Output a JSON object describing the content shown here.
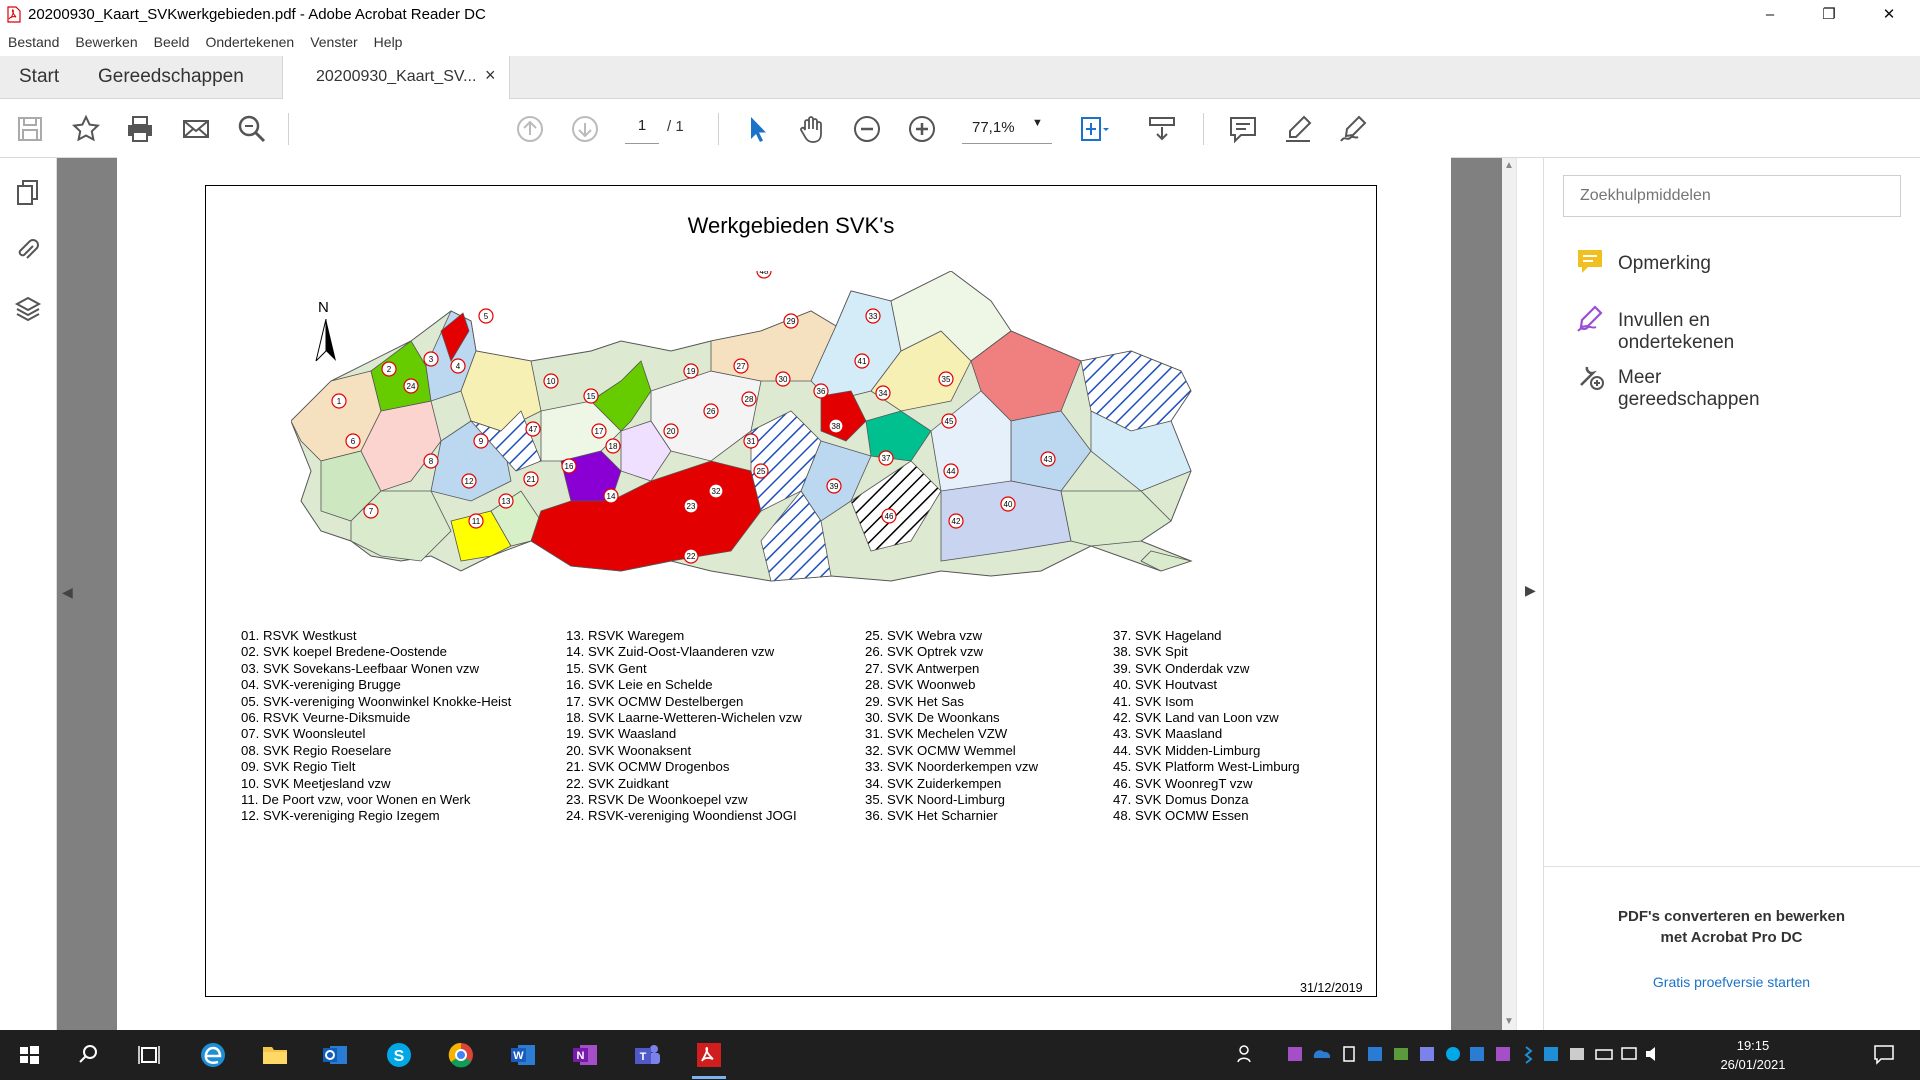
{
  "window": {
    "title": "20200930_Kaart_SVKwerkgebieden.pdf - Adobe Acrobat Reader DC",
    "minimize": "–",
    "maximize": "❐",
    "close": "✕"
  },
  "menu": [
    "Bestand",
    "Bewerken",
    "Beeld",
    "Ondertekenen",
    "Venster",
    "Help"
  ],
  "tabs": {
    "start": "Start",
    "tools": "Gereedschappen",
    "document": "20200930_Kaart_SV...",
    "close": "×"
  },
  "toolbar": {
    "icons": [
      "save-icon",
      "star-icon",
      "print-icon",
      "mail-icon",
      "zoom-search-icon",
      "page-up-icon",
      "page-down-icon",
      "select-cursor-icon",
      "hand-icon",
      "zoom-out-icon",
      "zoom-in-icon",
      "fit-page-icon",
      "scroll-mode-icon",
      "comment-icon",
      "highlight-pen-icon",
      "sign-icon"
    ],
    "page_current": "1",
    "page_total": "/ 1",
    "zoom": "77,1%"
  },
  "map": {
    "title": "Werkgebieden SVK's",
    "north": "N",
    "date": "31/12/2019",
    "colors": {
      "red": "#e30000",
      "green": "#66cc00",
      "purple": "#8a00d4",
      "yellow": "#ffff00",
      "teal": "#00c090",
      "pink": "#f08080",
      "lightblue": "#bcd7f0",
      "hatch": "#1f4fbf"
    }
  },
  "legend": {
    "col1": [
      "01. RSVK Westkust",
      "02. SVK koepel Bredene-Oostende",
      "03. SVK Sovekans-Leefbaar Wonen vzw",
      "04. SVK-vereniging Brugge",
      "05. SVK-vereniging Woonwinkel Knokke-Heist",
      "06. RSVK Veurne-Diksmuide",
      "07. SVK Woonsleutel",
      "08. SVK Regio Roeselare",
      "09. SVK Regio Tielt",
      "10. SVK Meetjesland vzw",
      "11. De Poort vzw, voor Wonen en Werk",
      "12. SVK-vereniging Regio Izegem"
    ],
    "col2": [
      "13. RSVK Waregem",
      "14. SVK Zuid-Oost-Vlaanderen vzw",
      "15. SVK Gent",
      "16. SVK Leie en Schelde",
      "17. SVK OCMW Destelbergen",
      "18. SVK Laarne-Wetteren-Wichelen vzw",
      "19. SVK Waasland",
      "20. SVK Woonaksent",
      "21. SVK OCMW Drogenbos",
      "22. SVK Zuidkant",
      "23. RSVK De Woonkoepel vzw",
      "24. RSVK-vereniging Woondienst JOGI"
    ],
    "col3": [
      "25. SVK Webra vzw",
      "26. SVK Optrek vzw",
      "27. SVK Antwerpen",
      "28. SVK Woonweb",
      "29. SVK Het Sas",
      "30. SVK De Woonkans",
      "31. SVK Mechelen VZW",
      "32. SVK OCMW Wemmel",
      "33. SVK Noorderkempen vzw",
      "34. SVK Zuiderkempen",
      "35. SVK Noord-Limburg",
      "36. SVK Het Scharnier"
    ],
    "col4": [
      "37. SVK Hageland",
      "38. SVK Spit",
      "39. SVK Onderdak vzw",
      "40. SVK Houtvast",
      "41. SVK Isom",
      "42. SVK Land van Loon vzw",
      "43. SVK Maasland",
      "44. SVK Midden-Limburg",
      "45. SVK Platform West-Limburg",
      "46. SVK WoonregT vzw",
      "47. SVK Domus Donza",
      "48. SVK OCMW Essen"
    ]
  },
  "right_panel": {
    "search_placeholder": "Zoekhulpmiddelen",
    "tools": [
      "Opmerking",
      "Invullen en ondertekenen",
      "Meer gereedschappen"
    ],
    "tool_colors": {
      "comment": "#f0c020",
      "fill": "#9b4fd1",
      "more": "#555555"
    },
    "promo_line1": "PDF's converteren en bewerken",
    "promo_line2": "met Acrobat Pro DC",
    "trial_link": "Gratis proefversie starten"
  },
  "taskbar": {
    "apps": [
      "windows-start-icon",
      "search-icon",
      "task-view-icon",
      "edge-icon",
      "file-explorer-icon",
      "outlook-icon",
      "skype-icon",
      "chrome-icon",
      "word-icon",
      "onenote-icon",
      "teams-icon",
      "acrobat-icon"
    ],
    "time": "19:15",
    "date": "26/01/2021"
  }
}
